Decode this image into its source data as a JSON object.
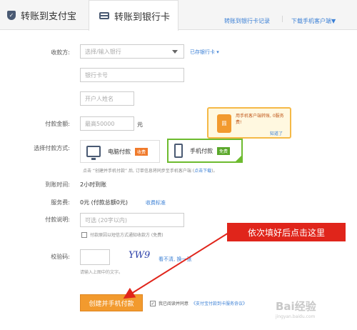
{
  "tabs": {
    "alipay_label": "转账到支付宝",
    "bank_label": "转账到银行卡",
    "records_link": "转账到银行卡记录",
    "download_link": "下载手机客户端▼",
    "separator": "|"
  },
  "form": {
    "payee_label": "收款方:",
    "bank_select_placeholder": "选择/输入银行",
    "saved_cards_link": "已存银行卡 ▾",
    "card_number_placeholder": "银行卡号",
    "account_name_placeholder": "开户人姓名",
    "amount_label": "付款金额:",
    "amount_placeholder": "最高50000",
    "amount_unit": "元",
    "method_label": "选择付款方式:",
    "pc_pay_label": "电脑付款",
    "pc_pay_badge": "收费",
    "mobile_pay_label": "手机付款",
    "mobile_pay_badge": "免费",
    "method_hint": "点击 “创建并手机付款” 后, 订单信息将同步至手机客户端 (",
    "method_hint_link": "点击下载",
    "method_hint_end": ")。",
    "arrival_label": "到账时间:",
    "arrival_value": "2小时到账",
    "fee_label": "服务费:",
    "fee_value": "0元 (付款总额0元)",
    "fee_link": "收费标准",
    "note_label": "付款说明:",
    "note_placeholder": "可选 (20字以内)",
    "notify_text": "付款原因以短信方式通知收款方 (免费)",
    "captcha_label": "校验码:",
    "captcha_image_text": "YW9",
    "captcha_refresh": "看不清, 换一张",
    "captcha_hint": "请输入上图中的文字。",
    "submit_label": "创建并手机付款",
    "agree_text": "我已阅读并同意",
    "agree_link": "《支付宝付款到卡服务协议》"
  },
  "tooltip": {
    "phone_icon_text": "圆",
    "text": "用手机客户端转账, 0服务费!",
    "link": "知道了"
  },
  "callout": {
    "text": "依次填好后点击这里"
  },
  "watermark": {
    "text": "Bai经验",
    "sub": "jingyan.baidu.com"
  },
  "colors": {
    "accent": "#f29a2e",
    "link": "#3a7fd5",
    "callout": "#e0251b",
    "selected": "#6dbb2f"
  }
}
